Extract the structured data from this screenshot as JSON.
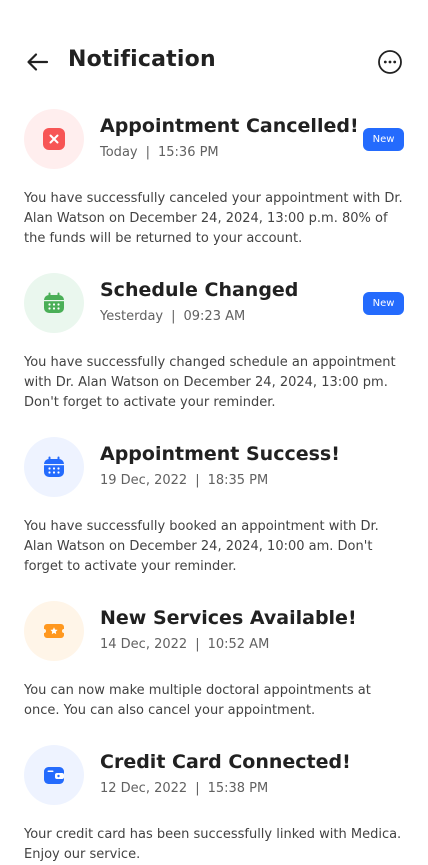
{
  "header": {
    "title": "Notification",
    "back_icon": "arrow-left-icon",
    "more_icon": "more-circle-icon"
  },
  "notifications": [
    {
      "title": "Appointment Cancelled!",
      "date": "Today",
      "time": "15:36 PM",
      "badge": "New",
      "icon": "cancel-icon",
      "icon_color": "#F75555",
      "icon_bg": "#FFEEEE",
      "body": "You have successfully canceled your appointment with Dr. Alan Watson on December 24, 2024, 13:00 p.m. 80% of the funds will be returned to your account."
    },
    {
      "title": "Schedule Changed",
      "date": "Yesterday",
      "time": "09:23 AM",
      "badge": "New",
      "icon": "calendar-icon",
      "icon_color": "#4AAF57",
      "icon_bg": "#EAF7EE",
      "body": "You have successfully changed schedule an appointment with Dr. Alan Watson on December 24, 2024, 13:00 pm. Don't forget to activate your reminder."
    },
    {
      "title": "Appointment Success!",
      "date": "19 Dec, 2022",
      "time": "18:35 PM",
      "icon": "calendar-icon",
      "icon_color": "#246BFD",
      "icon_bg": "#EEF3FF",
      "body": "You have successfully booked an appointment with Dr. Alan Watson on December 24, 2024, 10:00 am. Don't forget to activate your reminder."
    },
    {
      "title": "New Services Available!",
      "date": "14 Dec, 2022",
      "time": "10:52 AM",
      "icon": "ticket-star-icon",
      "icon_color": "#FF981F",
      "icon_bg": "#FFF5E8",
      "body": "You can now make multiple doctoral appointments at once. You can also cancel your appointment."
    },
    {
      "title": "Credit Card Connected!",
      "date": "12 Dec, 2022",
      "time": "15:38 PM",
      "icon": "wallet-icon",
      "icon_color": "#246BFD",
      "icon_bg": "#EEF3FF",
      "body": "Your credit card has been successfully linked with Medica. Enjoy our service."
    }
  ]
}
